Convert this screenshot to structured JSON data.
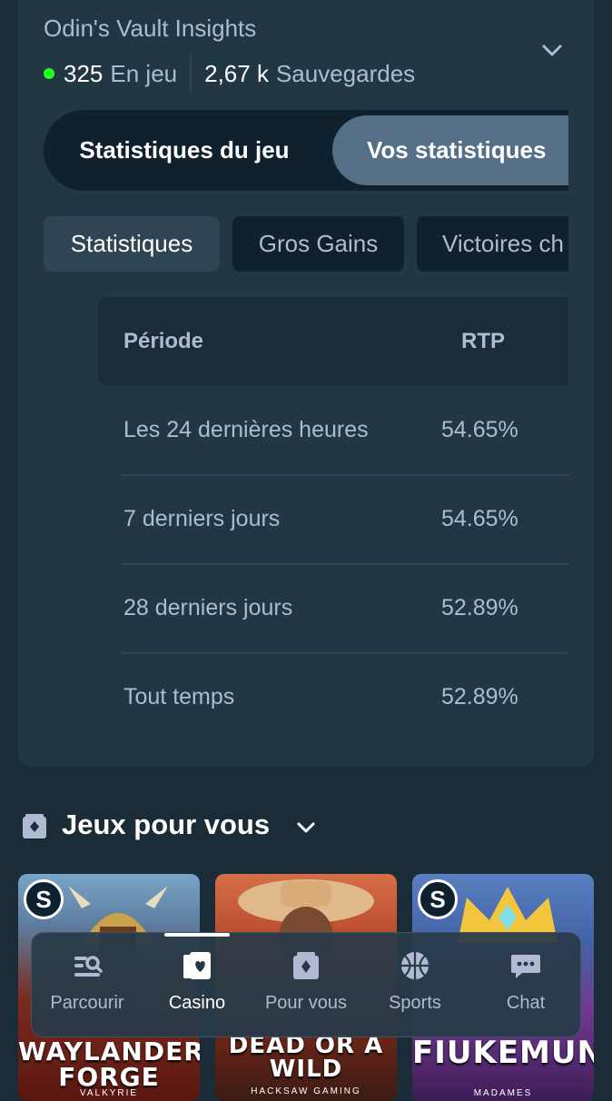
{
  "header": {
    "game_title": "Odin's Vault Insights",
    "playing_count": "325",
    "playing_label": "En jeu",
    "saves_count": "2,67 k",
    "saves_label": "Sauvegardes"
  },
  "segment_tabs": [
    {
      "label": "Statistiques du jeu",
      "active": false
    },
    {
      "label": "Vos statistiques",
      "active": true
    }
  ],
  "sub_tabs": [
    {
      "label": "Statistiques",
      "active": true
    },
    {
      "label": "Gros Gains",
      "active": false
    },
    {
      "label": "Victoires ch",
      "active": false
    }
  ],
  "table": {
    "headers": [
      "Période",
      "RTP"
    ],
    "rows": [
      {
        "period": "Les 24 dernières heures",
        "rtp": "54.65%"
      },
      {
        "period": "7 derniers jours",
        "rtp": "54.65%"
      },
      {
        "period": "28 derniers jours",
        "rtp": "52.89%"
      },
      {
        "period": "Tout temps",
        "rtp": "52.89%"
      }
    ]
  },
  "section": {
    "title": "Jeux pour vous"
  },
  "games": [
    {
      "title": "WAYLANDERS FORGE",
      "subtitle": "VALKYRIE",
      "badge": "S"
    },
    {
      "title": "DEAD OR A WILD",
      "subtitle": "HACKSAW GAMING",
      "badge": ""
    },
    {
      "title": "FIUKEMUN",
      "subtitle": "MADAMES",
      "badge": "S"
    }
  ],
  "bottom_nav": [
    {
      "label": "Parcourir",
      "icon": "browse-icon",
      "active": false
    },
    {
      "label": "Casino",
      "icon": "casino-cards-icon",
      "active": true
    },
    {
      "label": "Pour vous",
      "icon": "for-you-icon",
      "active": false
    },
    {
      "label": "Sports",
      "icon": "basketball-icon",
      "active": false
    },
    {
      "label": "Chat",
      "icon": "chat-icon",
      "active": false
    }
  ],
  "colors": {
    "background": "#1a2c38",
    "card": "#213743",
    "dark": "#0f212e",
    "muted_text": "#b1bad3",
    "active_segment": "#557086",
    "online_dot": "#1fff20"
  }
}
